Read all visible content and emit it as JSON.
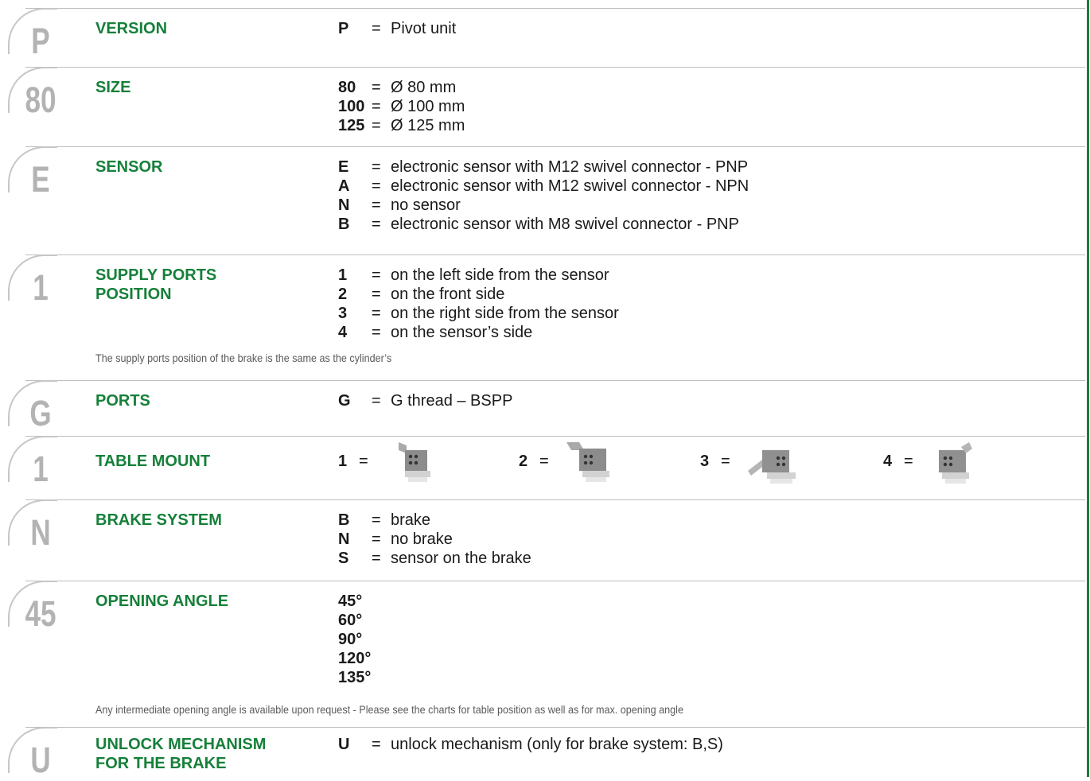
{
  "sections": {
    "version": {
      "code": "P",
      "title": "VERSION",
      "options": [
        {
          "key": "P",
          "eq": "=",
          "text": "Pivot unit"
        }
      ]
    },
    "size": {
      "code": "80",
      "title": "SIZE",
      "options": [
        {
          "key": "80",
          "eq": "=",
          "text": "Ø 80 mm"
        },
        {
          "key": "100",
          "eq": "=",
          "text": "Ø 100 mm"
        },
        {
          "key": "125",
          "eq": "=",
          "text": "Ø 125 mm"
        }
      ]
    },
    "sensor": {
      "code": "E",
      "title": "SENSOR",
      "options": [
        {
          "key": "E",
          "eq": "=",
          "text": "electronic sensor with M12 swivel connector - PNP"
        },
        {
          "key": "A",
          "eq": "=",
          "text": "electronic sensor with M12 swivel connector - NPN"
        },
        {
          "key": "N",
          "eq": "=",
          "text": "no sensor"
        },
        {
          "key": "B",
          "eq": "=",
          "text": "electronic sensor with M8 swivel connector - PNP"
        }
      ]
    },
    "supply": {
      "code": "1",
      "title_line1": "SUPPLY PORTS",
      "title_line2": "POSITION",
      "options": [
        {
          "key": "1",
          "eq": "=",
          "text": "on the left side from the sensor"
        },
        {
          "key": "2",
          "eq": "=",
          "text": "on the front side"
        },
        {
          "key": "3",
          "eq": "=",
          "text": "on the right side from the sensor"
        },
        {
          "key": "4",
          "eq": "=",
          "text": "on the sensor’s side"
        }
      ],
      "note": "The supply ports position of the brake is the same as the cylinder’s"
    },
    "ports": {
      "code": "G",
      "title": "PORTS",
      "options": [
        {
          "key": "G",
          "eq": "=",
          "text": "G thread – BSPP"
        }
      ]
    },
    "table_mount": {
      "code": "1",
      "title": "TABLE MOUNT",
      "options": [
        {
          "key": "1",
          "eq": "="
        },
        {
          "key": "2",
          "eq": "="
        },
        {
          "key": "3",
          "eq": "="
        },
        {
          "key": "4",
          "eq": "="
        }
      ]
    },
    "brake": {
      "code": "N",
      "title": "BRAKE SYSTEM",
      "options": [
        {
          "key": "B",
          "eq": "=",
          "text": "brake"
        },
        {
          "key": "N",
          "eq": "=",
          "text": "no brake"
        },
        {
          "key": "S",
          "eq": "=",
          "text": "sensor on the brake"
        }
      ]
    },
    "angle": {
      "code": "45",
      "title": "OPENING ANGLE",
      "options": [
        {
          "key": "45°"
        },
        {
          "key": "60°"
        },
        {
          "key": "90°"
        },
        {
          "key": "120°"
        },
        {
          "key": "135°"
        }
      ],
      "note": "Any intermediate opening angle is available upon request - Please see the charts for table position as well as for max. opening angle"
    },
    "unlock": {
      "code": "U",
      "title_line1": "UNLOCK MECHANISM",
      "title_line2": "FOR THE BRAKE",
      "options": [
        {
          "key": "U",
          "eq": "=",
          "text": "unlock mechanism (only for brake system: B,S)"
        }
      ]
    }
  }
}
